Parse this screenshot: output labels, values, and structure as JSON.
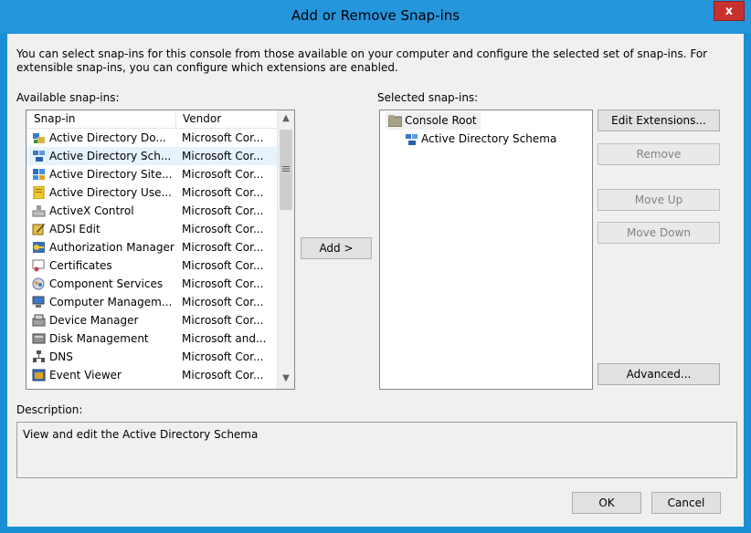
{
  "window": {
    "title": "Add or Remove Snap-ins",
    "close_label": "x"
  },
  "intro": "You can select snap-ins for this console from those available on your computer and configure the selected set of snap-ins. For extensible snap-ins, you can configure which extensions are enabled.",
  "available": {
    "label": "Available snap-ins:",
    "columns": [
      "Snap-in",
      "Vendor"
    ],
    "rows": [
      {
        "name": "Active Directory Do...",
        "vendor": "Microsoft Cor...",
        "icon": "ad-domains-icon"
      },
      {
        "name": "Active Directory Sch...",
        "vendor": "Microsoft Cor...",
        "icon": "ad-schema-icon",
        "selected": true
      },
      {
        "name": "Active Directory Site...",
        "vendor": "Microsoft Cor...",
        "icon": "ad-sites-icon"
      },
      {
        "name": "Active Directory Use...",
        "vendor": "Microsoft Cor...",
        "icon": "ad-users-icon"
      },
      {
        "name": "ActiveX Control",
        "vendor": "Microsoft Cor...",
        "icon": "activex-icon"
      },
      {
        "name": "ADSI Edit",
        "vendor": "Microsoft Cor...",
        "icon": "adsi-edit-icon"
      },
      {
        "name": "Authorization Manager",
        "vendor": "Microsoft Cor...",
        "icon": "authorization-manager-icon"
      },
      {
        "name": "Certificates",
        "vendor": "Microsoft Cor...",
        "icon": "certificates-icon"
      },
      {
        "name": "Component Services",
        "vendor": "Microsoft Cor...",
        "icon": "component-services-icon"
      },
      {
        "name": "Computer Managem...",
        "vendor": "Microsoft Cor...",
        "icon": "computer-management-icon"
      },
      {
        "name": "Device Manager",
        "vendor": "Microsoft Cor...",
        "icon": "device-manager-icon"
      },
      {
        "name": "Disk Management",
        "vendor": "Microsoft and...",
        "icon": "disk-management-icon"
      },
      {
        "name": "DNS",
        "vendor": "Microsoft Cor...",
        "icon": "dns-icon"
      },
      {
        "name": "Event Viewer",
        "vendor": "Microsoft Cor...",
        "icon": "event-viewer-icon"
      }
    ]
  },
  "add_button": "Add >",
  "selected": {
    "label": "Selected snap-ins:",
    "root": "Console Root",
    "child": "Active Directory Schema"
  },
  "buttons": {
    "edit_extensions": "Edit Extensions...",
    "remove": "Remove",
    "move_up": "Move Up",
    "move_down": "Move Down",
    "advanced": "Advanced...",
    "ok": "OK",
    "cancel": "Cancel"
  },
  "description": {
    "label": "Description:",
    "text": "View and edit the Active Directory Schema"
  },
  "colors": {
    "title_bar": "#2595dc",
    "close": "#c7312e",
    "selected_row": "#e5f3fb"
  }
}
